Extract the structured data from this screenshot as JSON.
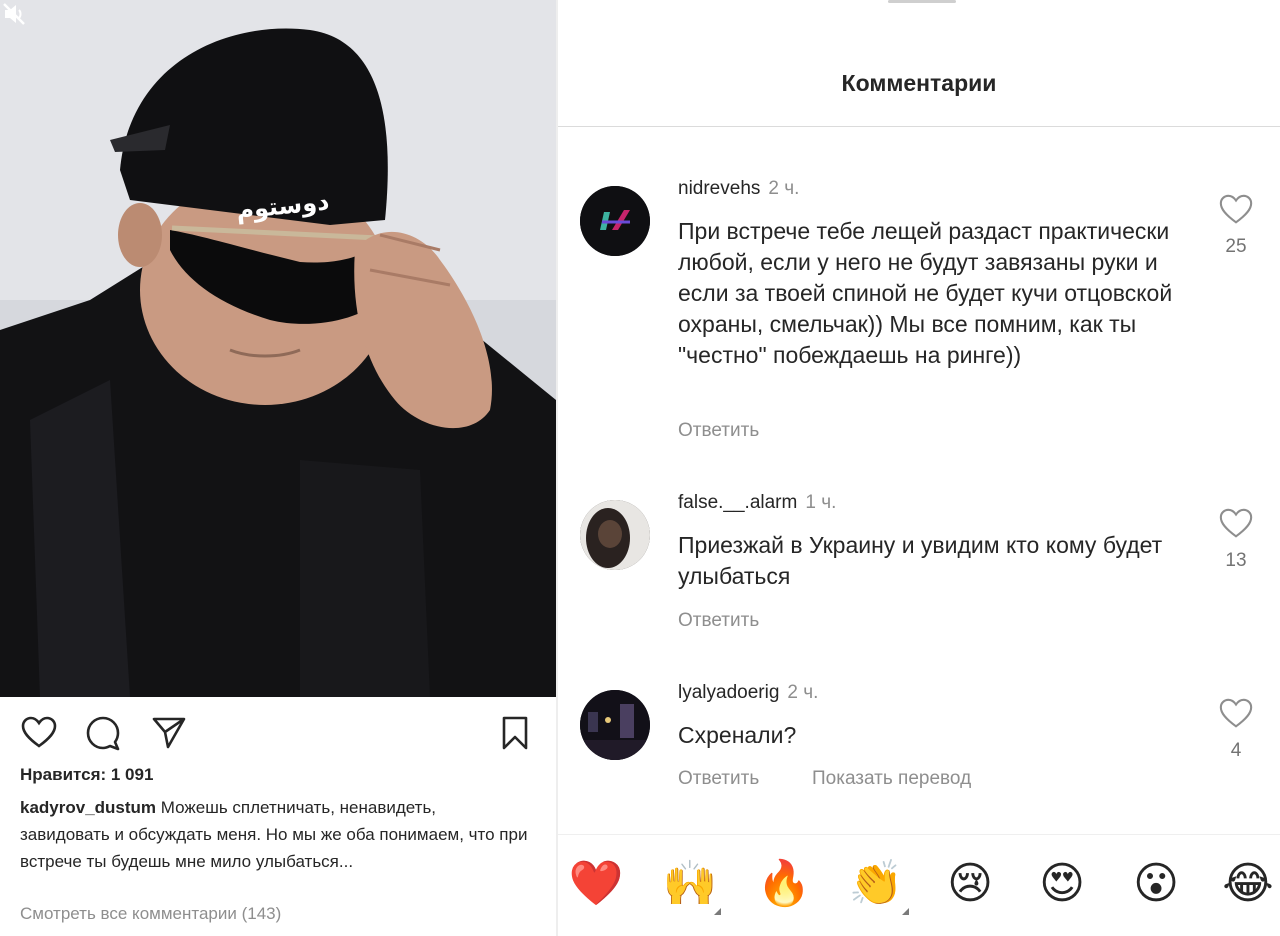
{
  "post": {
    "likes_label": "Нравится: 1 091",
    "caption_user": "kadyrov_dustum",
    "caption_text": " Можешь сплетничать, ненавидеть, завидовать и обсуждать меня. Но мы же оба понимаем, что при встрече ты будешь мне мило улыбаться...",
    "view_all_comments": "Смотреть все комментарии (143)",
    "photo_cap_text": "دوستوم",
    "icons": {
      "like": "heart-icon",
      "comment": "comment-bubble-icon",
      "share": "paper-plane-icon",
      "save": "bookmark-icon",
      "mute": "speaker-muted-icon"
    }
  },
  "comments_panel": {
    "title": "Комментарии",
    "reply_label": "Ответить",
    "translate_label": "Показать перевод",
    "items": [
      {
        "username": "nidrevehs",
        "time": "2 ч.",
        "text": "При встрече тебе лещей раздаст практически любой, если у него не будут завязаны руки и если за твоей спиной не будет кучи отцовской охраны, смельчак)) Мы все помним, как ты \"честно\" побеждаешь на ринге))",
        "likes": "25"
      },
      {
        "username": "false.__.alarm",
        "time": "1 ч.",
        "text": "Приезжай в Украину и увидим кто кому будет улыбаться",
        "likes": "13"
      },
      {
        "username": "lyalyadoerig",
        "time": "2 ч.",
        "text": "Схренали?",
        "likes": "4"
      }
    ],
    "emoji_reactions": [
      "❤️",
      "🙌",
      "🔥",
      "👏",
      "😢",
      "😍",
      "😮",
      "😂"
    ]
  },
  "colors": {
    "text_primary": "#262626",
    "text_secondary": "#8e8e8e",
    "divider": "#dbdbdb",
    "avatar_accent_1": "#c6246b",
    "avatar_accent_2": "#3db3a0"
  }
}
